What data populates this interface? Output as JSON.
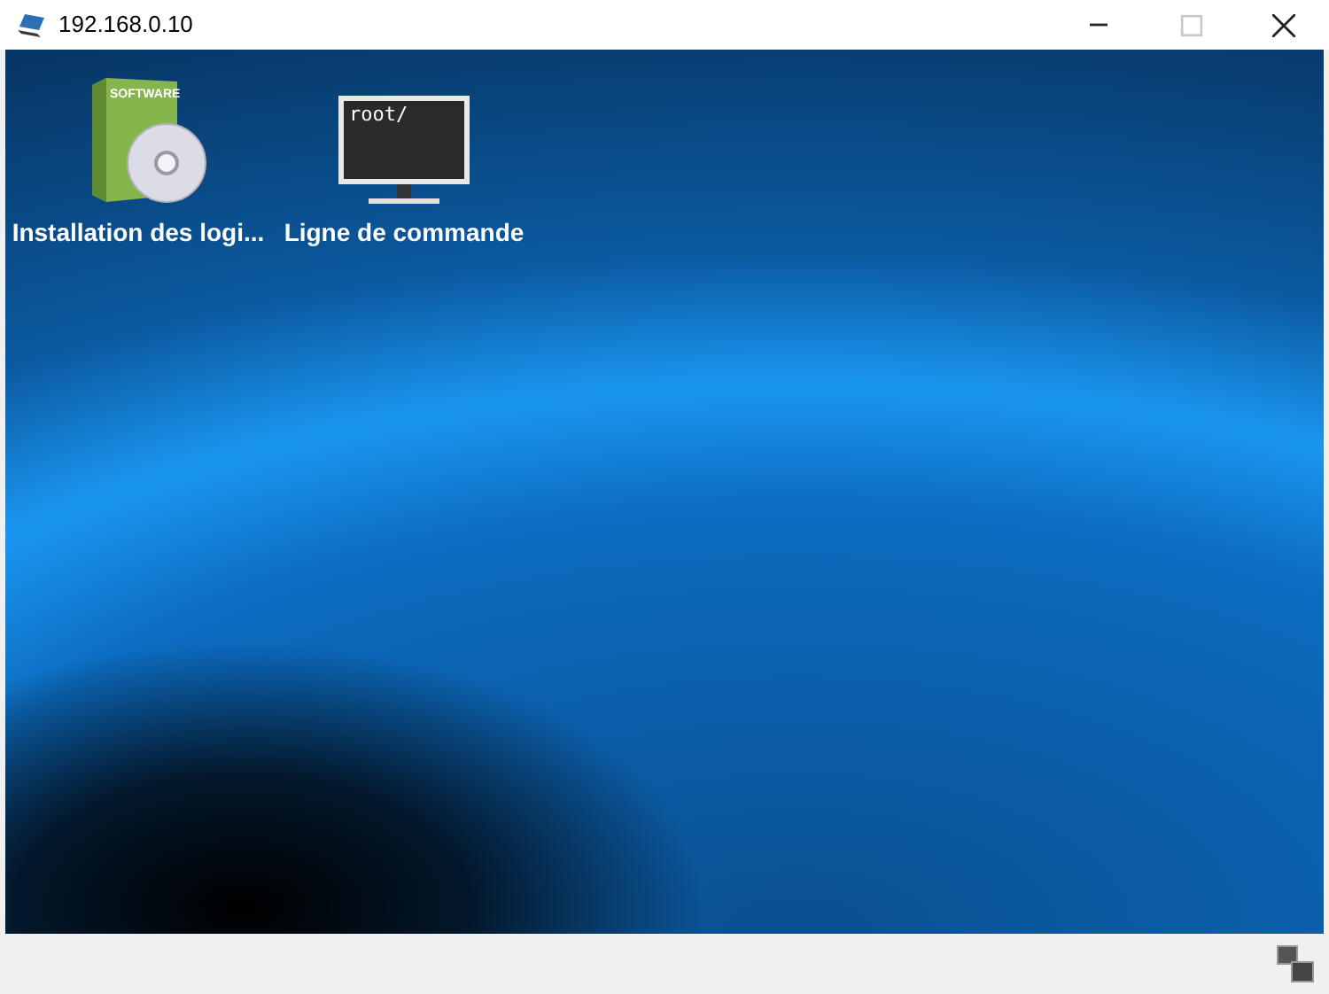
{
  "window": {
    "title": "192.168.0.10",
    "controls": [
      {
        "kind": "minimize",
        "disabled": false
      },
      {
        "kind": "maximize",
        "disabled": true
      },
      {
        "kind": "close",
        "disabled": false
      }
    ]
  },
  "desktop": {
    "icons": [
      {
        "kind": "software",
        "label": "Installation des logi...",
        "art_text": "SOFTWARE"
      },
      {
        "kind": "terminal",
        "label": "Ligne de commande",
        "art_text": "root/"
      }
    ]
  }
}
